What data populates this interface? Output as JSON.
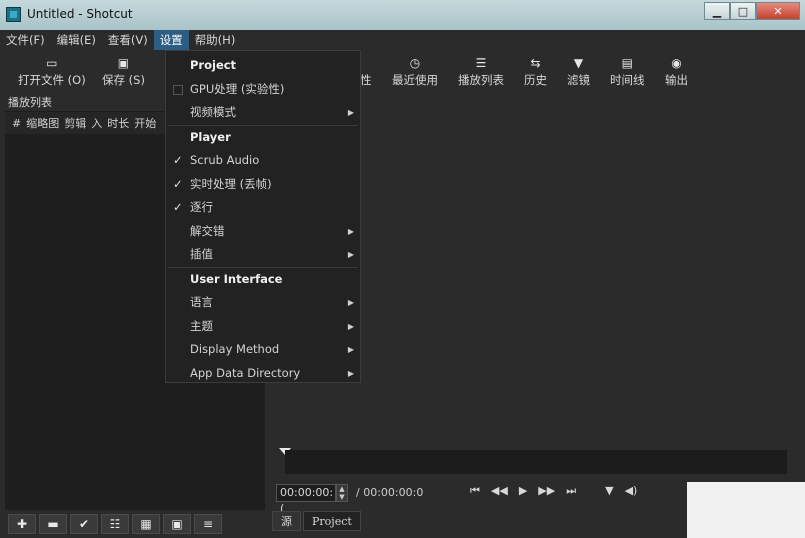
{
  "window": {
    "title": "Untitled - Shotcut",
    "controls": {
      "minimize": "▁",
      "maximize": "□",
      "close": "✕"
    }
  },
  "menubar": [
    {
      "label": "文件(F)"
    },
    {
      "label": "编辑(E)"
    },
    {
      "label": "查看(V)"
    },
    {
      "label": "设置"
    },
    {
      "label": "帮助(H)"
    }
  ],
  "toolbar": {
    "open": {
      "label": "打开文件 (O)",
      "icon": "folder-icon"
    },
    "save": {
      "label": "保存 (S)",
      "icon": "save-icon"
    },
    "properties": {
      "label": "性",
      "icon": "properties-icon"
    },
    "recent": {
      "label": "最近使用",
      "icon": "clock-icon"
    },
    "playlist": {
      "label": "播放列表",
      "icon": "list-icon"
    },
    "history": {
      "label": "历史",
      "icon": "history-icon"
    },
    "filters": {
      "label": "滤镜",
      "icon": "filter-icon"
    },
    "timeline": {
      "label": "时间线",
      "icon": "timeline-icon"
    },
    "export": {
      "label": "输出",
      "icon": "export-icon"
    }
  },
  "playlist": {
    "title": "播放列表",
    "columns": [
      "#",
      "缩略图",
      "剪辑",
      "入",
      "时长",
      "开始"
    ]
  },
  "settings_menu": {
    "project_header": "Project",
    "gpu": "GPU处理 (实验性)",
    "video_mode": "视频模式",
    "player_header": "Player",
    "scrub_audio": "Scrub Audio",
    "realtime": "实时处理 (丢帧)",
    "progressive": "逐行",
    "deinterlacer": "解交错",
    "interpolation": "插值",
    "ui_header": "User Interface",
    "language": "语言",
    "theme": "主题",
    "display_method": "Display Method",
    "app_data_dir": "App Data Directory",
    "checked": [
      "Scrub Audio",
      "实时处理 (丢帧)",
      "逐行"
    ]
  },
  "player": {
    "position": "00:00:00:(",
    "duration_sep": "/",
    "duration": "00:00:00:0"
  },
  "tabs": [
    {
      "label": "源"
    },
    {
      "label": "Project"
    }
  ]
}
